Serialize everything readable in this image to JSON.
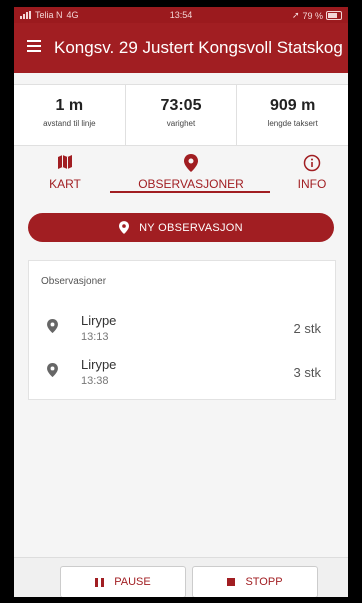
{
  "status_bar": {
    "carrier": "Telia N",
    "network": "4G",
    "time": "13:54",
    "battery": "79 %",
    "battery_level": 0.79
  },
  "header": {
    "title": "Kongsv. 29 Justert Kongsvoll Statskog"
  },
  "stats": [
    {
      "value": "1 m",
      "label": "avstand til linje"
    },
    {
      "value": "73:05",
      "label": "varighet"
    },
    {
      "value": "909 m",
      "label": "lengde taksert"
    }
  ],
  "tabs": {
    "kart": "KART",
    "observasjoner": "OBSERVASJONER",
    "info": "INFO",
    "active": "observasjoner"
  },
  "new_observation_button": "NY OBSERVASJON",
  "observations": {
    "header": "Observasjoner",
    "items": [
      {
        "species": "Lirype",
        "time": "13:13",
        "count": "2 stk"
      },
      {
        "species": "Lirype",
        "time": "13:38",
        "count": "3 stk"
      }
    ]
  },
  "bottom": {
    "pause_label": "PAUSE",
    "stop_label": "STOPP"
  },
  "colors": {
    "primary": "#a11e22",
    "statusbar": "#9b1a1e",
    "background": "#f5f5f5"
  }
}
